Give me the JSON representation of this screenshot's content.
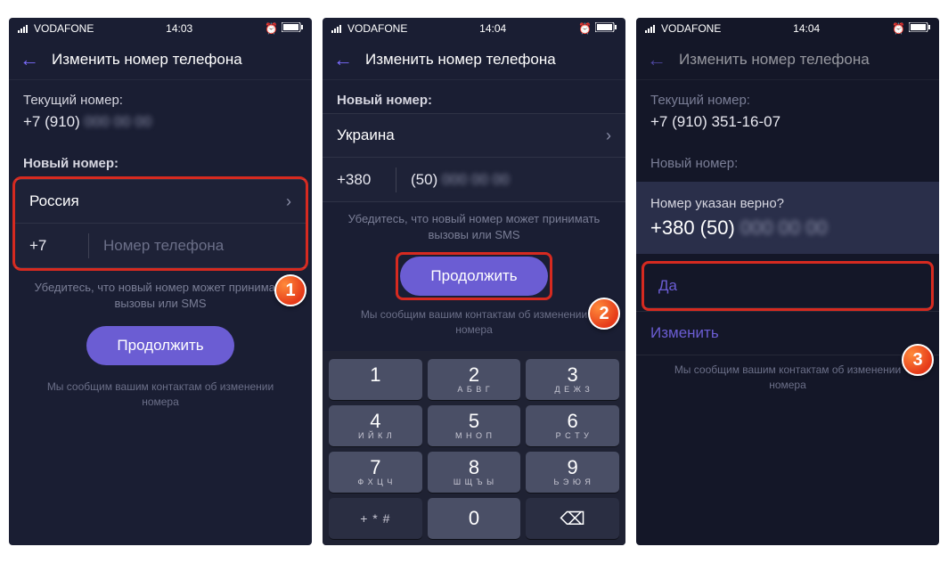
{
  "status": {
    "carrier": "VODAFONE",
    "time1": "14:03",
    "time2": "14:04",
    "time3": "14:04"
  },
  "header": {
    "title": "Изменить номер телефона"
  },
  "s1": {
    "current_label": "Текущий номер:",
    "current_num_prefix": "+7 (910)",
    "current_num_rest": "000 00 00",
    "new_label": "Новый номер:",
    "country": "Россия",
    "prefix": "+7",
    "placeholder": "Номер телефона",
    "hint": "Убедитесь, что новый номер может принимать вызовы или SMS",
    "continue": "Продолжить",
    "footer": "Мы сообщим вашим контактам об изменении номера"
  },
  "s2": {
    "new_label": "Новый номер:",
    "country": "Украина",
    "prefix": "+380",
    "area": "(50)",
    "rest": "000 00 00",
    "hint": "Убедитесь, что новый номер может принимать вызовы или SMS",
    "continue": "Продолжить",
    "footer": "Мы сообщим вашим контактам об изменении номера",
    "keypad": {
      "k1": "1",
      "k2": "2",
      "k3": "3",
      "l2": "А Б В Г",
      "l3": "Д Е Ж З",
      "k4": "4",
      "k5": "5",
      "k6": "6",
      "l4": "И Й К Л",
      "l5": "М Н О П",
      "l6": "Р С Т У",
      "k7": "7",
      "k8": "8",
      "k9": "9",
      "l7": "Ф Х Ц Ч",
      "l8": "Ш Щ Ъ Ы",
      "l9": "Ь Э Ю Я",
      "k0": "0",
      "kplus": "+ * #"
    }
  },
  "s3": {
    "current_label": "Текущий номер:",
    "current_num": "+7 (910) 351-16-07",
    "new_label": "Новый номер:",
    "confirm_q": "Номер указан верно?",
    "confirm_prefix": "+380 (50)",
    "confirm_rest": "000 00 00",
    "yes": "Да",
    "edit": "Изменить",
    "footer": "Мы сообщим вашим контактам об изменении номера"
  },
  "badges": {
    "b1": "1",
    "b2": "2",
    "b3": "3"
  }
}
